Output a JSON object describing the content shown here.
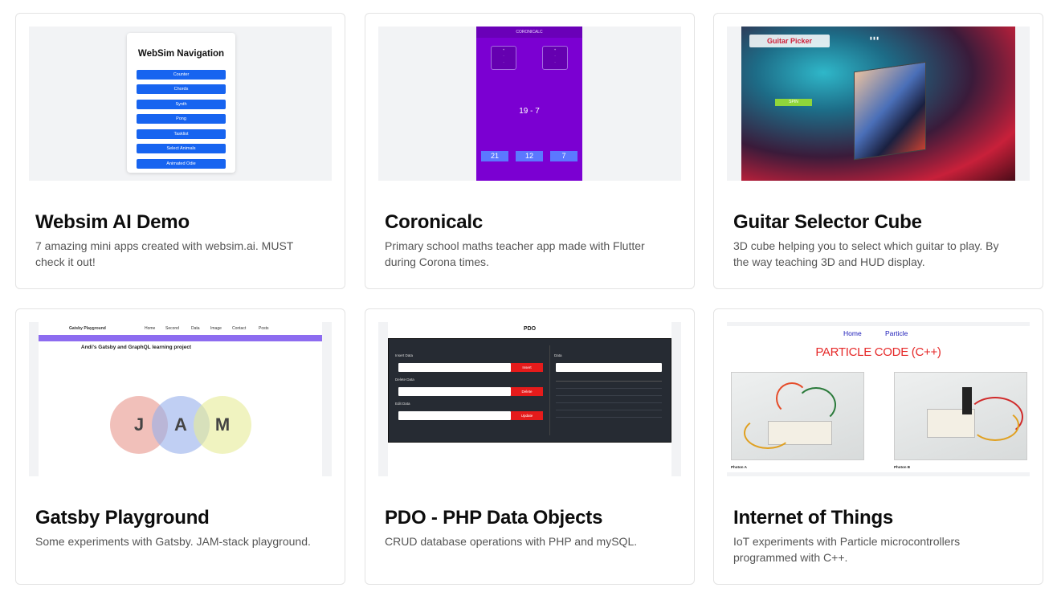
{
  "cards": [
    {
      "title": "Websim AI Demo",
      "description": "7 amazing mini apps created with websim.ai. MUST check it out!",
      "thumb": {
        "heading": "WebSim Navigation",
        "buttons": [
          "Counter",
          "Chords",
          "Synth",
          "Pong",
          "Tasklist",
          "Select Animals",
          "Animated Odie"
        ]
      }
    },
    {
      "title": "Coronicalc",
      "description": "Primary school maths teacher app made with Flutter during Corona times.",
      "thumb": {
        "app_bar": "CORONICALC",
        "question": "19 - 7",
        "answers": [
          "21",
          "12",
          "7"
        ]
      }
    },
    {
      "title": "Guitar Selector Cube",
      "description": "3D cube helping you to select which guitar to play. By the way teaching 3D and HUD display.",
      "thumb": {
        "logo": "Guitar Picker",
        "spin": "SPIN"
      }
    },
    {
      "title": "Gatsby Playground",
      "description": "Some experiments with Gatsby. JAM-stack playground.",
      "thumb": {
        "brand": "Gatsby Playground",
        "nav": [
          "Home",
          "Second",
          "Data",
          "Image",
          "Contact",
          "Posts"
        ],
        "heading": "Andi's Gatsby and GraphQL learning project",
        "letters": [
          "J",
          "A",
          "M"
        ]
      }
    },
    {
      "title": "PDO - PHP Data Objects",
      "description": "CRUD database operations with PHP and mySQL.",
      "thumb": {
        "heading": "PDO",
        "sections": [
          "Insert Data",
          "Delete Data",
          "Edit Data",
          "Data"
        ],
        "buttons": [
          "Insert",
          "Delete",
          "Update"
        ]
      }
    },
    {
      "title": "Internet of Things",
      "description": "IoT experiments with Particle microcontrollers programmed with C++.",
      "thumb": {
        "nav": [
          "Home",
          "Particle"
        ],
        "heading": "PARTICLE CODE (C++)",
        "captions": [
          "Photon A",
          "Photon B"
        ]
      }
    }
  ]
}
